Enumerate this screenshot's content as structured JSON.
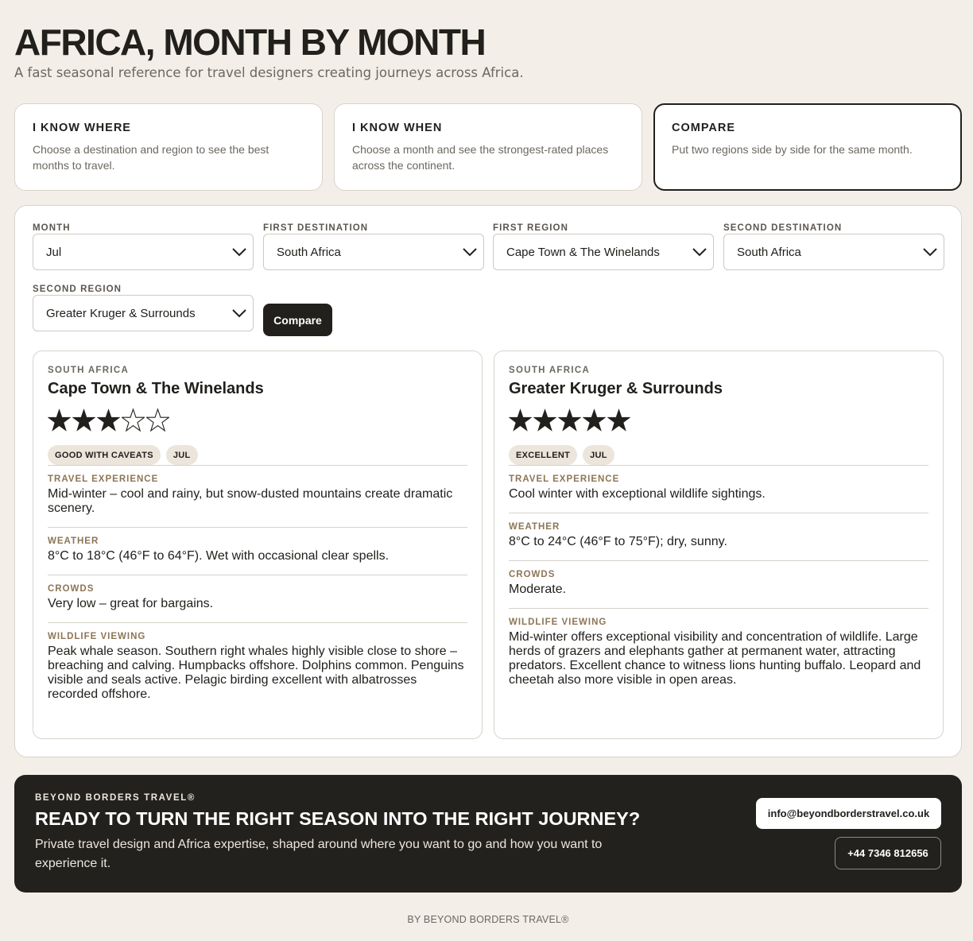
{
  "header": {
    "title": "AFRICA, MONTH BY MONTH",
    "subtitle": "A fast seasonal reference for travel designers creating journeys across Africa."
  },
  "modes": [
    {
      "title": "I KNOW WHERE",
      "description": "Choose a destination and region to see the best months to travel.",
      "active": false
    },
    {
      "title": "I KNOW WHEN",
      "description": "Choose a month and see the strongest-rated places across the continent.",
      "active": false
    },
    {
      "title": "COMPARE",
      "description": "Put two regions side by side for the same month.",
      "active": true
    }
  ],
  "filters": {
    "month": {
      "label": "MONTH",
      "value": "Jul"
    },
    "first_destination": {
      "label": "FIRST DESTINATION",
      "value": "South Africa"
    },
    "first_region": {
      "label": "FIRST REGION",
      "value": "Cape Town & The Winelands"
    },
    "second_destination": {
      "label": "SECOND DESTINATION",
      "value": "South Africa"
    },
    "second_region": {
      "label": "SECOND REGION",
      "value": "Greater Kruger & Surrounds"
    },
    "compare_label": "Compare"
  },
  "cards": [
    {
      "country": "SOUTH AFRICA",
      "region": "Cape Town & The Winelands",
      "rating": 3,
      "rating_max": 5,
      "rating_chip": "GOOD WITH CAVEATS",
      "month_chip": "JUL",
      "sections": [
        {
          "label": "TRAVEL EXPERIENCE",
          "text": "Mid-winter – cool and rainy, but snow-dusted mountains create dramatic scenery."
        },
        {
          "label": "WEATHER",
          "text": "8°C to 18°C (46°F to 64°F). Wet with occasional clear spells."
        },
        {
          "label": "CROWDS",
          "text": "Very low – great for bargains."
        },
        {
          "label": "WILDLIFE VIEWING",
          "text": "Peak whale season. Southern right whales highly visible close to shore – breaching and calving. Humpbacks offshore. Dolphins common. Penguins visible and seals active. Pelagic birding excellent with albatrosses recorded offshore."
        }
      ]
    },
    {
      "country": "SOUTH AFRICA",
      "region": "Greater Kruger & Surrounds",
      "rating": 5,
      "rating_max": 5,
      "rating_chip": "EXCELLENT",
      "month_chip": "JUL",
      "sections": [
        {
          "label": "TRAVEL EXPERIENCE",
          "text": "Cool winter with exceptional wildlife sightings."
        },
        {
          "label": "WEATHER",
          "text": "8°C to 24°C (46°F to 75°F); dry, sunny."
        },
        {
          "label": "CROWDS",
          "text": "Moderate."
        },
        {
          "label": "WILDLIFE VIEWING",
          "text": "Mid-winter offers exceptional visibility and concentration of wildlife. Large herds of grazers and elephants gather at permanent water, attracting predators. Excellent chance to witness lions hunting buffalo. Leopard and cheetah also more visible in open areas."
        }
      ]
    }
  ],
  "cta": {
    "brand": "BEYOND BORDERS TRAVEL®",
    "headline": "READY TO TURN THE RIGHT SEASON INTO THE RIGHT JOURNEY?",
    "text": "Private travel design and Africa expertise, shaped around where you want to go and how you want to experience it.",
    "email": "info@beyondborderstravel.co.uk",
    "phone": "+44 7346 812656"
  },
  "footer": {
    "text": "BY BEYOND BORDERS TRAVEL®"
  },
  "icons": {
    "select_chevron": "chevron-down-icon",
    "star_filled": "star-filled-icon",
    "star_empty": "star-outline-icon"
  },
  "colors": {
    "background": "#f3eee8",
    "ink": "#22201c",
    "muted": "#6c6761",
    "accent_label": "#8c7656",
    "chip": "#ebe5dc",
    "cta_background": "#23211e"
  }
}
